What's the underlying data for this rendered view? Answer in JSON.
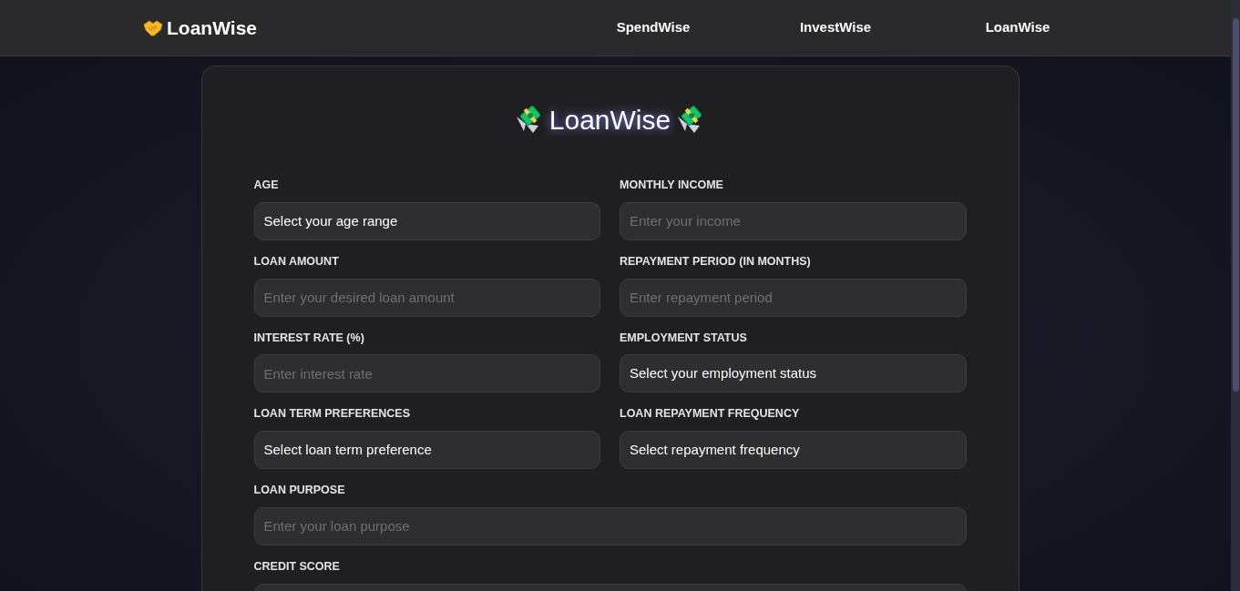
{
  "navbar": {
    "brand": "LoanWise",
    "links": [
      {
        "label": "SpendWise"
      },
      {
        "label": "InvestWise"
      },
      {
        "label": "LoanWise"
      }
    ]
  },
  "form": {
    "title": "LoanWise",
    "fields": [
      {
        "label": "AGE",
        "kind": "select",
        "value": "Select your age range"
      },
      {
        "label": "MONTHLY INCOME",
        "kind": "input",
        "placeholder": "Enter your income"
      },
      {
        "label": "LOAN AMOUNT",
        "kind": "input",
        "placeholder": "Enter your desired loan amount"
      },
      {
        "label": "REPAYMENT PERIOD (IN MONTHS)",
        "kind": "input",
        "placeholder": "Enter repayment period"
      },
      {
        "label": "INTEREST RATE (%)",
        "kind": "input",
        "placeholder": "Enter interest rate"
      },
      {
        "label": "EMPLOYMENT STATUS",
        "kind": "select",
        "value": "Select your employment status"
      },
      {
        "label": "LOAN TERM PREFERENCES",
        "kind": "select",
        "value": "Select loan term preference"
      },
      {
        "label": "LOAN REPAYMENT FREQUENCY",
        "kind": "select",
        "value": "Select repayment frequency"
      },
      {
        "label": "LOAN PURPOSE",
        "kind": "input",
        "placeholder": "Enter your loan purpose",
        "wide": true
      },
      {
        "label": "CREDIT SCORE",
        "kind": "input",
        "wide": true
      }
    ]
  }
}
